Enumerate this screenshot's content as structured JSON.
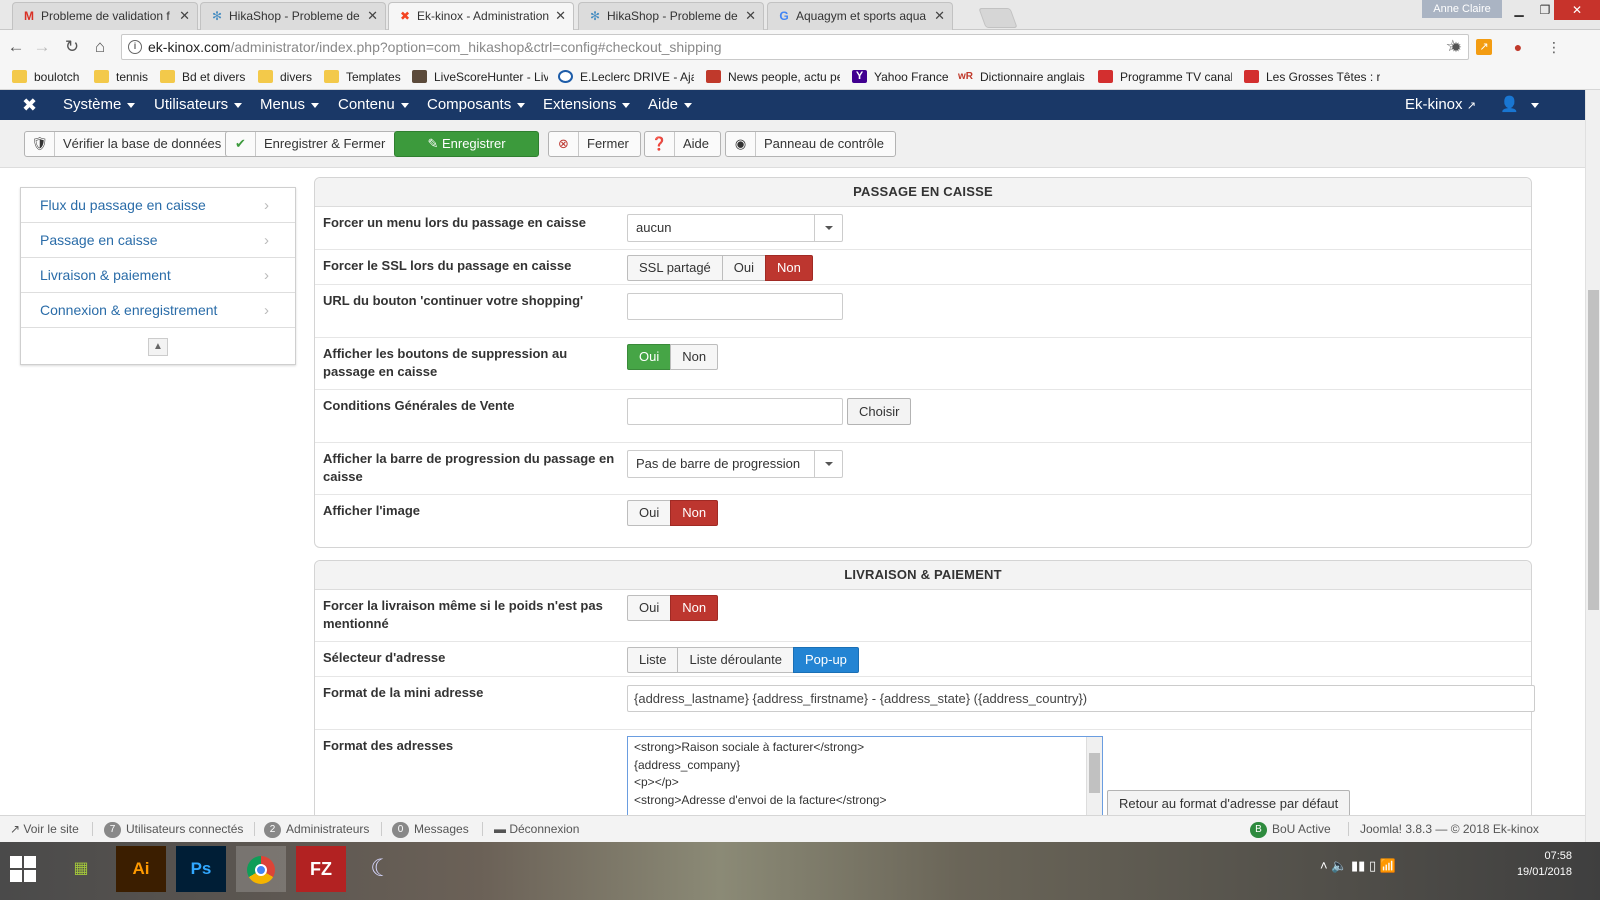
{
  "browser": {
    "tabs": [
      {
        "title": "Probleme de validation f",
        "icon": "gmail-icon"
      },
      {
        "title": "HikaShop - Probleme de",
        "icon": "hikashop-icon"
      },
      {
        "title": "Ek-kinox - Administration",
        "icon": "joomla-icon"
      },
      {
        "title": "HikaShop - Probleme de",
        "icon": "hikashop-icon"
      },
      {
        "title": "Aquagym et sports aqua",
        "icon": "google-icon"
      }
    ],
    "user": "Anne Claire",
    "url_host": "ek-kinox.com",
    "url_path": "/administrator/index.php?option=com_hikashop&ctrl=config#checkout_shipping",
    "bookmarks": [
      "boulotch",
      "tennis",
      "Bd et divers",
      "divers",
      "Templates",
      "LiveScoreHunter - Liv",
      "E.Leclerc DRIVE - Ajac",
      "News people, actu pe",
      "Yahoo France",
      "Dictionnaire anglais",
      "Programme TV canal",
      "Les Grosses Têtes : re"
    ]
  },
  "joomla_nav": {
    "menus": [
      "Système",
      "Utilisateurs",
      "Menus",
      "Contenu",
      "Composants",
      "Extensions",
      "Aide"
    ],
    "site_link": "Ek-kinox"
  },
  "toolbar": {
    "check_db": "Vérifier la base de données",
    "save_close": "Enregistrer & Fermer",
    "save": "Enregistrer",
    "close": "Fermer",
    "help": "Aide",
    "control_panel": "Panneau de contrôle"
  },
  "sidenav": {
    "items": [
      "Flux du passage en caisse",
      "Passage en caisse",
      "Livraison & paiement",
      "Connexion & enregistrement"
    ]
  },
  "checkout": {
    "title": "PASSAGE EN CAISSE",
    "force_menu_label": "Forcer un menu lors du passage en caisse",
    "force_menu_value": "aucun",
    "force_ssl_label": "Forcer le SSL lors du passage en caisse",
    "force_ssl_options": [
      "SSL partagé",
      "Oui",
      "Non"
    ],
    "continue_url_label": "URL du bouton 'continuer votre shopping'",
    "delete_buttons_label": "Afficher les boutons de suppression au passage en caisse",
    "delete_buttons_options": [
      "Oui",
      "Non"
    ],
    "terms_label": "Conditions Générales de Vente",
    "terms_button": "Choisir",
    "progress_label": "Afficher la barre de progression du passage en caisse",
    "progress_value": "Pas de barre de progression",
    "image_label": "Afficher l'image",
    "image_options": [
      "Oui",
      "Non"
    ]
  },
  "shipping": {
    "title": "LIVRAISON & PAIEMENT",
    "force_ship_label": "Forcer la livraison même si le poids n'est pas mentionné",
    "force_ship_options": [
      "Oui",
      "Non"
    ],
    "address_selector_label": "Sélecteur d'adresse",
    "address_selector_options": [
      "Liste",
      "Liste déroulante",
      "Pop-up"
    ],
    "mini_address_label": "Format de la mini adresse",
    "mini_address_value": "{address_lastname} {address_firstname} -  {address_state} ({address_country})",
    "address_format_label": "Format des adresses",
    "address_format_lines": [
      "<strong>Raison sociale à facturer</strong>",
      "{address_company}",
      "<p></p>",
      "<strong>Adresse d'envoi de la facture</strong>"
    ],
    "reset_button": "Retour au format d'adresse par défaut"
  },
  "statusbar": {
    "view_site": "Voir le site",
    "users_count": "7",
    "users_label": "Utilisateurs connectés",
    "admins_count": "2",
    "admins_label": "Administrateurs",
    "messages_count": "0",
    "messages_label": "Messages",
    "logout": "Déconnexion",
    "bou": "BoU Active",
    "version": "Joomla! 3.8.3  —  © 2018 Ek-kinox"
  },
  "taskbar": {
    "time": "07:58",
    "date": "19/01/2018"
  },
  "colors": {
    "navbar": "#1a3867",
    "save_green": "#3c9a3c",
    "toggle_red": "#bd362f",
    "toggle_green": "#46a546",
    "toggle_blue": "#2384d3",
    "link_blue": "#2a6ca8"
  }
}
